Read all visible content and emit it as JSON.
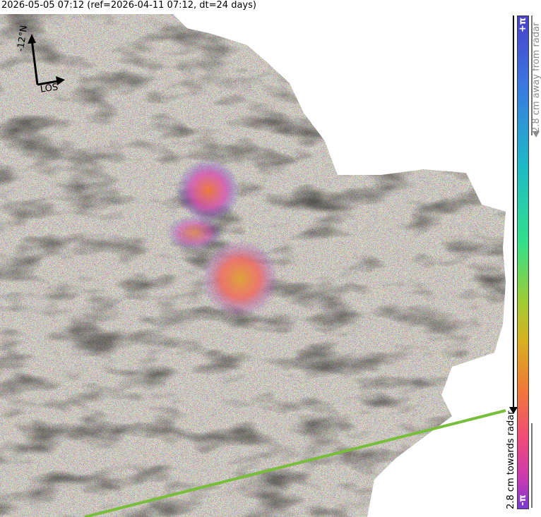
{
  "title": "2026-05-05 07:12 (ref=2026-04-11 07:12, dt=24 days)",
  "compass": {
    "north_label": "-12°N",
    "los_label": "LOS"
  },
  "colorbar": {
    "top_label": "+π",
    "bottom_label": "-π",
    "away_label": "2.8 cm away from radar",
    "towards_label": "2.8 cm towards radar",
    "colors": [
      "#4a40c8",
      "#3a78e0",
      "#1fb8c8",
      "#33e08a",
      "#a0cc33",
      "#d8b020",
      "#f07838",
      "#f04a7a",
      "#c83ab0",
      "#7a3ad0"
    ]
  },
  "map": {
    "icons": [
      "interferogram-image",
      "fault-line"
    ],
    "colors": {
      "fault_line": "#78be3a",
      "background": "#ffffff"
    }
  }
}
